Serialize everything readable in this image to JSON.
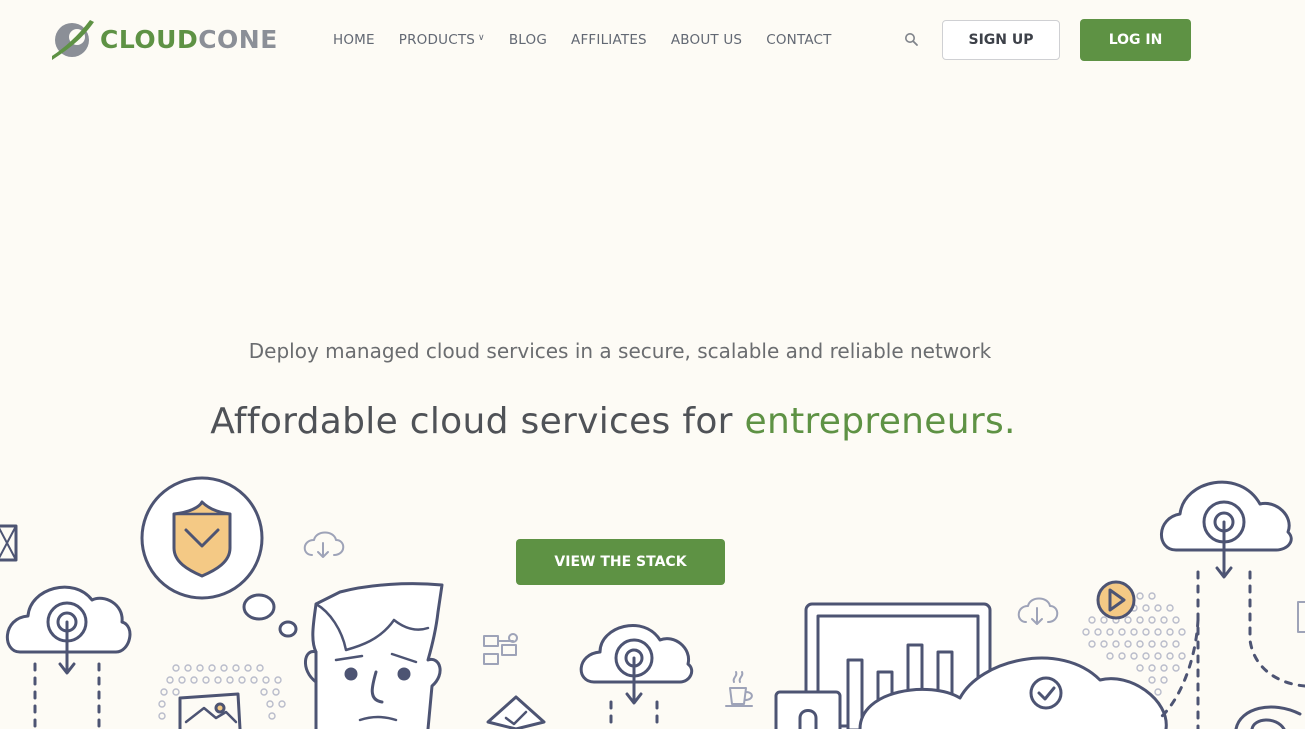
{
  "brand": {
    "name_part1": "CLOUD",
    "name_part2": "CONE",
    "primary_color": "#5e9244",
    "secondary_color": "#8b8f97"
  },
  "nav": {
    "items": [
      {
        "label": "HOME"
      },
      {
        "label": "PRODUCTS",
        "has_dropdown": true
      },
      {
        "label": "BLOG"
      },
      {
        "label": "AFFILIATES"
      },
      {
        "label": "ABOUT US"
      },
      {
        "label": "CONTACT"
      }
    ],
    "dropdown_icon": "chevron-down-icon",
    "search_icon": "search-icon",
    "signup_label": "SIGN UP",
    "login_label": "LOG IN"
  },
  "hero": {
    "subtitle": "Deploy managed cloud services in a secure, scalable and reliable network",
    "headline_main": "Affordable cloud services for ",
    "headline_accent": "entrepreneurs.",
    "cta_label": "VIEW THE STACK"
  },
  "illustration": {
    "icons": [
      "shield-icon",
      "cloud-upload-icon",
      "person-face-icon",
      "monitor-chart-icon",
      "play-icon",
      "check-icon",
      "coffee-cup-icon",
      "flowchart-icon",
      "image-icon",
      "envelope-icon",
      "lock-icon"
    ]
  }
}
